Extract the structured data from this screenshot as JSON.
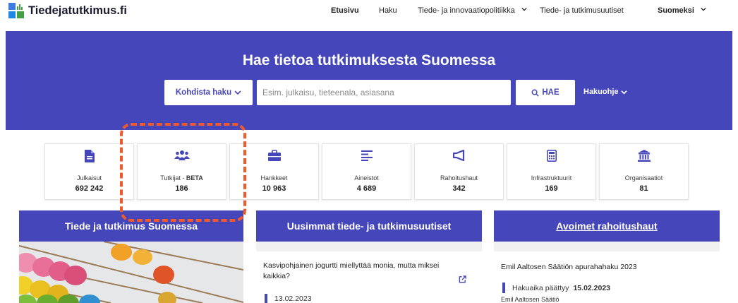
{
  "header": {
    "logo_text": "Tiedejatutkimus.fi",
    "nav": [
      {
        "label": "Etusivu",
        "active": true
      },
      {
        "label": "Haku"
      },
      {
        "label": "Tiede- ja innovaatiopolitiikka",
        "dropdown": true
      },
      {
        "label": "Tiede- ja tutkimusuutiset"
      }
    ],
    "language": "Suomeksi"
  },
  "hero": {
    "title": "Hae tietoa tutkimuksesta Suomessa",
    "target_button": "Kohdista haku",
    "search_placeholder": "Esim. julkaisu, tieteenala, asiasana",
    "search_button": "HAE",
    "help_link": "Hakuohje"
  },
  "stats": [
    {
      "label": "Julkaisut",
      "value": "692 242",
      "icon": "document-icon"
    },
    {
      "label": "Tutkijat - ",
      "label_bold": "BETA",
      "value": "186",
      "icon": "people-icon"
    },
    {
      "label": "Hankkeet",
      "value": "10 963",
      "icon": "briefcase-icon"
    },
    {
      "label": "Aineistot",
      "value": "4 689",
      "icon": "lines-icon"
    },
    {
      "label": "Rahoitushaut",
      "value": "342",
      "icon": "megaphone-icon"
    },
    {
      "label": "Infrastruktuurit",
      "value": "169",
      "icon": "calculator-icon"
    },
    {
      "label": "Organisaatiot",
      "value": "81",
      "icon": "institution-icon"
    }
  ],
  "columns": {
    "left_title": "Tiede ja tutkimus Suomessa",
    "news_title": "Uusimmat tiede- ja tutkimusuutiset",
    "news_item": {
      "title": "Kasvipohjainen jogurtti miellyttää monia, mutta miksei kaikkia?",
      "date": "13.02.2023"
    },
    "funding_title": "Avoimet rahoitushaut",
    "funding_item": {
      "title": "Emil Aaltosen Säätiön apurahahaku 2023",
      "deadline_label": "Hakuaika päättyy",
      "deadline": "15.02.2023",
      "organization": "Emil Aaltosen Säätiö"
    }
  },
  "colors": {
    "brand": "#4546b9",
    "highlight": "#f0592b"
  }
}
